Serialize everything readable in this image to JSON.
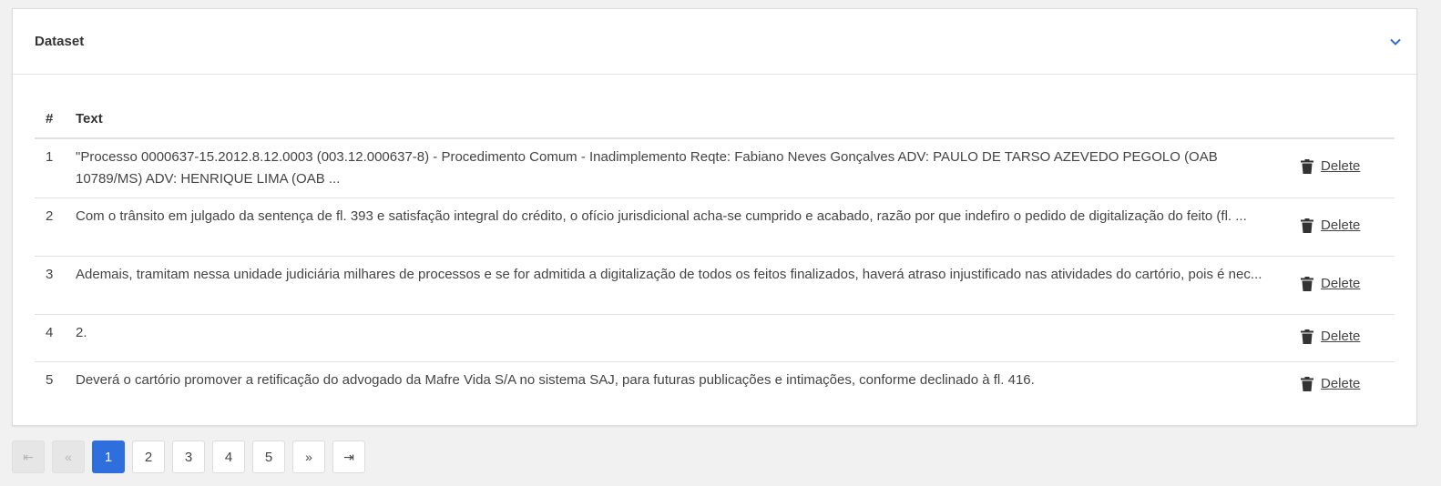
{
  "card": {
    "title": "Dataset",
    "toggle_icon": "chevron-down-icon",
    "accent_color": "#2f6fdd"
  },
  "table": {
    "headers": [
      "#",
      "Text"
    ],
    "rows": [
      {
        "num": "1",
        "text": "\"Processo 0000637-15.2012.8.12.0003 (003.12.000637-8) - Procedimento Comum - Inadimplemento Reqte: Fabiano Neves Gonçalves ADV: PAULO DE TARSO AZEVEDO PEGOLO (OAB 10789/MS) ADV: HENRIQUE LIMA (OAB ...",
        "action": "Delete"
      },
      {
        "num": "2",
        "text": "Com o trânsito em julgado da sentença de fl. 393 e satisfação integral do crédito, o ofício jurisdicional acha-se cumprido e acabado, razão por que indefiro o pedido de digitalização do feito (fl. ...",
        "action": "Delete"
      },
      {
        "num": "3",
        "text": "Ademais, tramitam nessa unidade judiciária milhares de processos e se for admitida a digitalização de todos os feitos finalizados, haverá atraso injustificado nas atividades do cartório, pois é nec...",
        "action": "Delete"
      },
      {
        "num": "4",
        "text": "2.",
        "action": "Delete"
      },
      {
        "num": "5",
        "text": "Deverá o cartório promover a retificação do advogado da Mafre Vida S/A no sistema SAJ, para futuras publicações e intimações, conforme declinado à fl. 416.",
        "action": "Delete"
      }
    ]
  },
  "pagination": {
    "first": "⇤",
    "prev": "«",
    "pages": [
      "1",
      "2",
      "3",
      "4",
      "5"
    ],
    "active_page": "1",
    "next": "»",
    "last": "⇥"
  }
}
